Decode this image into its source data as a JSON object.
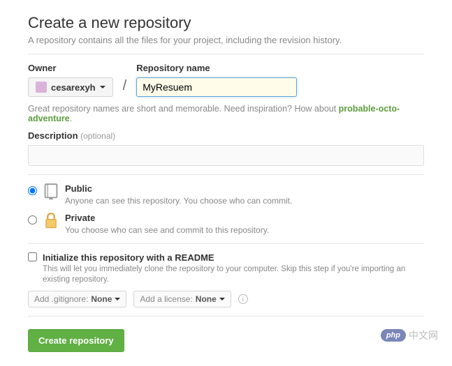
{
  "header": {
    "title": "Create a new repository",
    "subtitle": "A repository contains all the files for your project, including the revision history."
  },
  "owner": {
    "label": "Owner",
    "value": "cesarexyh"
  },
  "repo": {
    "label": "Repository name",
    "value": "MyResuem"
  },
  "hint": {
    "text_before": "Great repository names are short and memorable. Need inspiration? How about ",
    "suggestion": "probable-octo-adventure",
    "text_after": "."
  },
  "description": {
    "label": "Description",
    "optional": "(optional)",
    "value": ""
  },
  "visibility": {
    "public": {
      "title": "Public",
      "desc": "Anyone can see this repository. You choose who can commit.",
      "selected": true
    },
    "private": {
      "title": "Private",
      "desc": "You choose who can see and commit to this repository.",
      "selected": false
    }
  },
  "readme": {
    "title": "Initialize this repository with a README",
    "desc": "This will let you immediately clone the repository to your computer. Skip this step if you're importing an existing repository.",
    "checked": false
  },
  "gitignore": {
    "prefix": "Add .gitignore: ",
    "value": "None"
  },
  "license": {
    "prefix": "Add a license: ",
    "value": "None"
  },
  "submit": "Create repository",
  "watermark": {
    "badge": "php",
    "text": "中文网"
  }
}
